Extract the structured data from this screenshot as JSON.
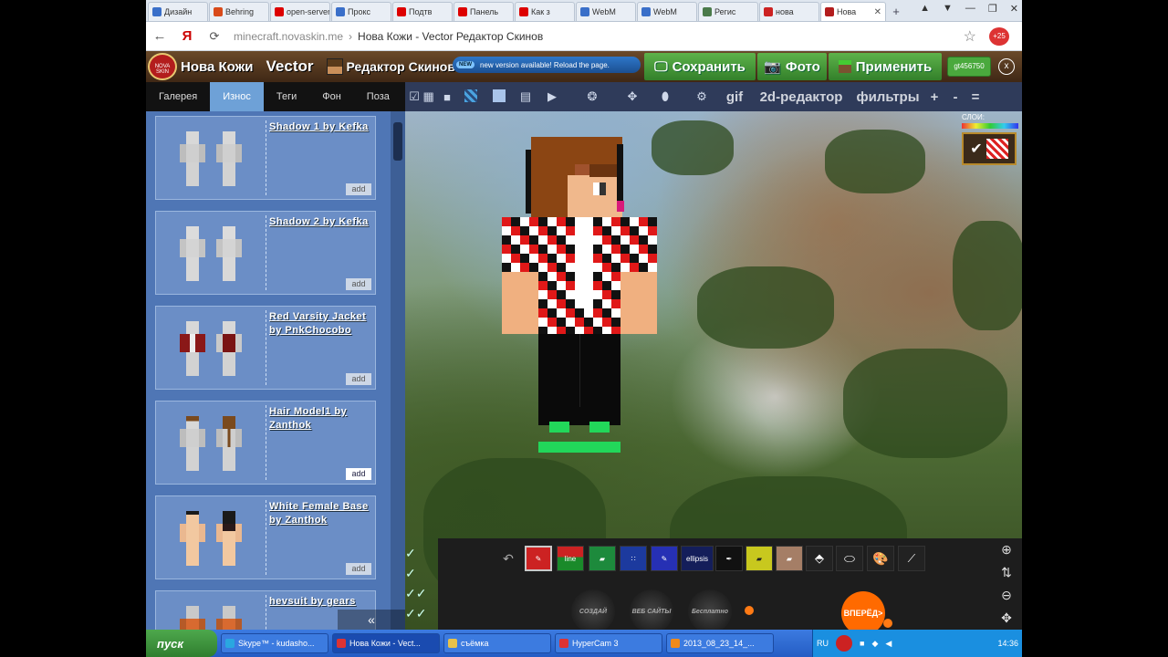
{
  "browser": {
    "tabs": [
      {
        "label": "Дизайн",
        "color": "#3a6fc9"
      },
      {
        "label": "Behring",
        "color": "#d94a1a"
      },
      {
        "label": "open-server",
        "color": "#d00"
      },
      {
        "label": "Прокс",
        "color": "#3a6fc9"
      },
      {
        "label": "Подтв",
        "color": "#d00"
      },
      {
        "label": "Панель",
        "color": "#d00"
      },
      {
        "label": "Как з",
        "color": "#d00"
      },
      {
        "label": "WebM",
        "color": "#3a6fc9"
      },
      {
        "label": "WebM",
        "color": "#3a6fc9"
      },
      {
        "label": "Регис",
        "color": "#4a7a4a"
      },
      {
        "label": "нова",
        "color": "#c22"
      }
    ],
    "active_tab": "Нова",
    "new_tab": "+",
    "window_controls": [
      "▲",
      "▼",
      "—",
      "❐",
      "✕"
    ],
    "address": {
      "domain": "minecraft.novaskin.me",
      "separator": "›",
      "path": "Нова Кожи - Vector Редактор Скинов"
    },
    "ext_badge": "+25"
  },
  "app": {
    "logo_text": "NOVA SKIN",
    "brand": "Нова Кожи",
    "vector": "Vector",
    "editor_title": "Редактор Скинов",
    "notice_badge": "NEW",
    "notice_text": "new version available! Reload the page.",
    "save_label": "Сохранить",
    "photo_label": "Фото",
    "apply_label": "Применить",
    "user": "gt456750",
    "close": "x"
  },
  "sidebar": {
    "tabs": [
      "Галерея",
      "Износ",
      "Теги",
      "Фон",
      "Поза"
    ],
    "active_tab_index": 1,
    "add_label": "add",
    "items": [
      {
        "title": "Shadow 1 by Kefka"
      },
      {
        "title": "Shadow 2 by Kefka"
      },
      {
        "title": "Red Varsity Jacket by PnkChocobo"
      },
      {
        "title": "Hair Model1 by Zanthok"
      },
      {
        "title": "White Female Base by Zanthok"
      },
      {
        "title": "hevsuit by gears"
      }
    ],
    "collapse": "«"
  },
  "toolbar": {
    "gif": "gif",
    "editor2d": "2d-редактор",
    "filters": "фильтры",
    "plus": "+",
    "minus": "-",
    "menu": "="
  },
  "layers": {
    "title": "СЛОИ:"
  },
  "tools": {
    "items": [
      "pencil",
      "line",
      "bucket",
      "spray",
      "fill",
      "ellipsis",
      "pipette",
      "eraser",
      "brush",
      "picker",
      "blob",
      "palette",
      "wand"
    ],
    "line_label": "line",
    "ellipsis_label": "ellipsis",
    "round_buttons": [
      "СОЗДАЙ",
      "ВЕБ САЙТЫ",
      "Бесплатно"
    ],
    "forward": "ВПЕРЁД>"
  },
  "taskbar": {
    "start": "пуск",
    "items": [
      {
        "label": "Skype™ - kudasho...",
        "color": "#2aa7e0"
      },
      {
        "label": "Нова Кожи - Vect...",
        "color": "#d33"
      },
      {
        "label": "съёмка",
        "color": "#e8c24a"
      },
      {
        "label": "HyperCam 3",
        "color": "#d33"
      },
      {
        "label": "2013_08_23_14_...",
        "color": "#f08a1a"
      }
    ],
    "lang": "RU",
    "clock": "14:36"
  }
}
